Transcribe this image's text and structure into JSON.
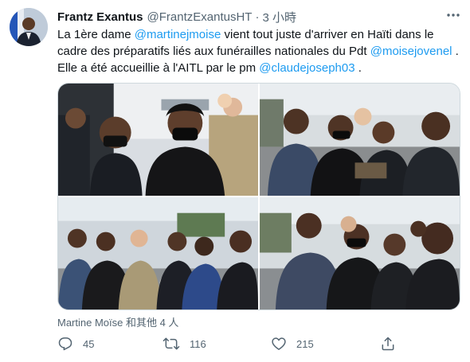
{
  "tweet": {
    "author_name": "Frantz Exantus",
    "author_handle": "@FrantzExantusHT",
    "separator": "·",
    "time_ago": "3 小時",
    "text": {
      "p1": "La 1ère dame ",
      "m1": "@martinejmoise",
      "p2": " vient tout juste d'arriver en Haïti dans le cadre des préparatifs liés aux funérailles nationales du Pdt ",
      "m2": "@moisejovenel",
      "p3": " . Elle a été accueillie à l'AITL par le pm ",
      "m3": "@claudejoseph03",
      "p4": " ."
    },
    "tagged_people": "Martine Moïse 和其他 4 人",
    "replies": "45",
    "retweets": "116",
    "likes": "215"
  },
  "icons": {
    "more": "more-dots-icon",
    "reply": "reply-icon",
    "retweet": "retweet-icon",
    "like": "heart-icon",
    "share": "share-icon"
  },
  "colors": {
    "link": "#1d9bf0",
    "secondary_text": "#536471",
    "primary_text": "#0f1419",
    "border": "#cfd9de"
  }
}
